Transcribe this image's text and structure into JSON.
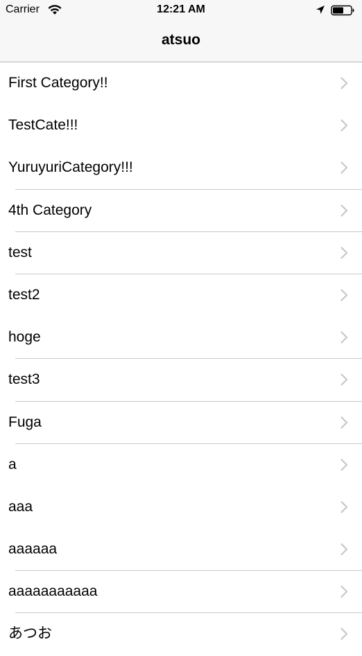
{
  "status_bar": {
    "carrier": "Carrier",
    "time": "12:21 AM",
    "icons": [
      "wifi-icon",
      "location-arrow-icon",
      "battery-icon"
    ]
  },
  "nav": {
    "title": "atsuo"
  },
  "categories": [
    {
      "label": "First Category!!",
      "separator": false
    },
    {
      "label": "TestCate!!!",
      "separator": false
    },
    {
      "label": "YuruyuriCategory!!!",
      "separator": true
    },
    {
      "label": "4th Category",
      "separator": true
    },
    {
      "label": "test",
      "separator": true
    },
    {
      "label": "test2",
      "separator": false
    },
    {
      "label": "hoge",
      "separator": true
    },
    {
      "label": "test3",
      "separator": true
    },
    {
      "label": "Fuga",
      "separator": true
    },
    {
      "label": "a",
      "separator": false
    },
    {
      "label": "aaa",
      "separator": false
    },
    {
      "label": "aaaaaa",
      "separator": true
    },
    {
      "label": "aaaaaaaaaaa",
      "separator": true
    },
    {
      "label": "あつお",
      "separator": false
    }
  ],
  "colors": {
    "bar_background": "#f7f7f7",
    "separator": "#c8c7cc",
    "chevron": "#c7c7cc",
    "text": "#000000"
  }
}
